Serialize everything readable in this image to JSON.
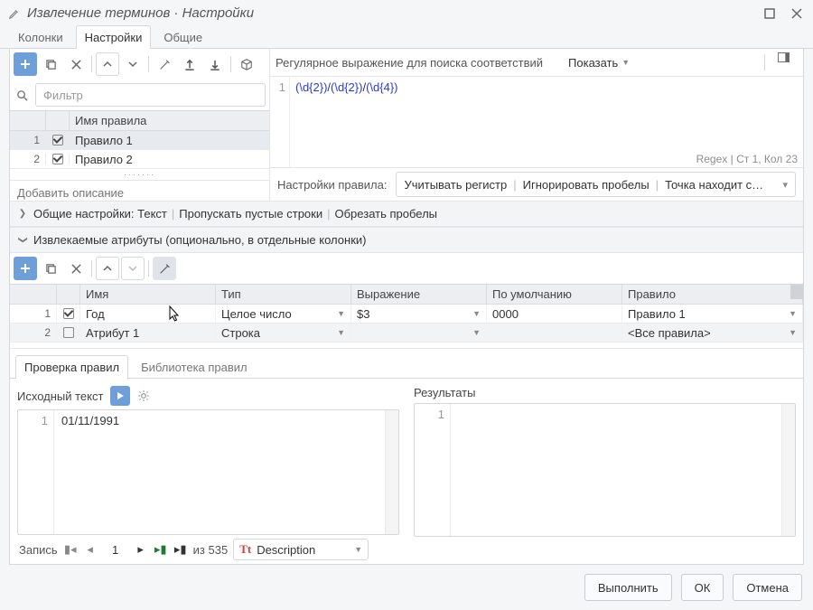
{
  "window": {
    "title": "Извлечение терминов · Настройки"
  },
  "mainTabs": [
    "Колонки",
    "Настройки",
    "Общие"
  ],
  "rules": {
    "filterPlaceholder": "Фильтр",
    "header": "Имя правила",
    "rows": [
      {
        "num": "1",
        "checked": true,
        "name": "Правило 1"
      },
      {
        "num": "2",
        "checked": true,
        "name": "Правило 2"
      }
    ],
    "descPlaceholder": "Добавить описание"
  },
  "regex": {
    "label": "Регулярное выражение для поиска соответствий",
    "showLabel": "Показать",
    "lineNo": "1",
    "g1": "(\\d{2})",
    "s1": "/",
    "g2": "(\\d{2})",
    "s2": "/",
    "g3": "(\\d{4})",
    "status": "Regex | Ст 1, Кол 23"
  },
  "ruleSettings": {
    "label": "Настройки правила:",
    "opt1": "Учитывать регистр",
    "opt2": "Игнорировать пробелы",
    "opt3": "Точка находит с…"
  },
  "sections": {
    "general_pref": "Общие настройки: ",
    "general_v1": "Текст",
    "general_v2": "Пропускать пустые строки",
    "general_v3": "Обрезать пробелы",
    "attrs": "Извлекаемые атрибуты (опционально, в отдельные колонки)"
  },
  "attrsTable": {
    "headers": {
      "name": "Имя",
      "type": "Тип",
      "expr": "Выражение",
      "def": "По умолчанию",
      "rule": "Правило"
    },
    "rows": [
      {
        "num": "1",
        "checked": true,
        "name": "Год",
        "type": "Целое число",
        "expr": "$3",
        "def": "0000",
        "rule": "Правило 1"
      },
      {
        "num": "2",
        "checked": false,
        "name": "Атрибут 1",
        "type": "Строка",
        "expr": "",
        "def": "",
        "rule": "<Все правила>"
      }
    ]
  },
  "subTabs": [
    "Проверка правил",
    "Библиотека правил"
  ],
  "test": {
    "srcLabel": "Исходный текст",
    "resLabel": "Результаты",
    "srcLineNo": "1",
    "srcText": "01/11/1991",
    "resLineNo": "1"
  },
  "pager": {
    "label": "Запись",
    "num": "1",
    "of": "из 535",
    "field": "Description"
  },
  "footer": {
    "execute": "Выполнить",
    "ok": "ОК",
    "cancel": "Отмена"
  }
}
